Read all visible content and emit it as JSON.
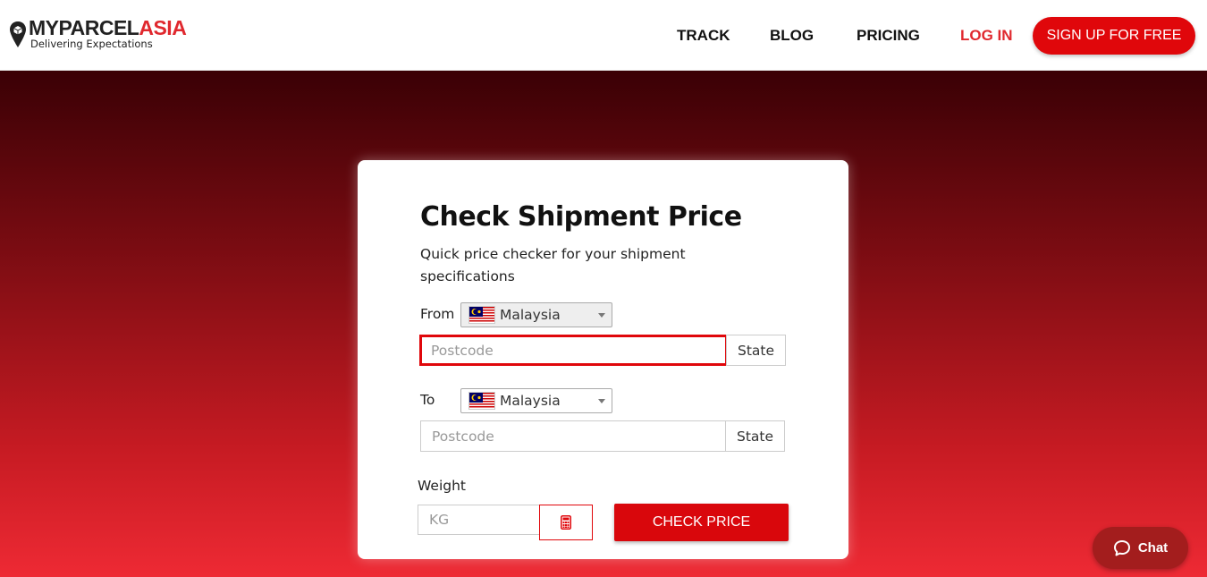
{
  "brand": {
    "name_main": "MYPARCEL",
    "name_accent": "ASIA",
    "tagline": "Delivering Expectations",
    "accent_color": "#e0282e"
  },
  "nav": {
    "track": "TRACK",
    "blog": "BLOG",
    "pricing": "PRICING",
    "login": "LOG IN",
    "signup": "SIGN UP FOR FREE"
  },
  "form": {
    "title": "Check Shipment Price",
    "subtitle": "Quick price checker for your shipment specifications",
    "from_label": "From",
    "from_country": "Malaysia",
    "from_postcode_placeholder": "Postcode",
    "from_state": "State",
    "to_label": "To",
    "to_country": "Malaysia",
    "to_postcode_placeholder": "Postcode",
    "to_state": "State",
    "weight_label": "Weight",
    "weight_placeholder": "KG",
    "calculator_icon": "calculator-icon",
    "submit": "CHECK PRICE"
  },
  "chat": {
    "label": "Chat",
    "icon": "chat-bubble-icon"
  },
  "colors": {
    "primary_red": "#e0070b",
    "hero_dark": "#3a0005",
    "hero_light": "#ee2a34",
    "chat_bg": "#a31d1d"
  }
}
